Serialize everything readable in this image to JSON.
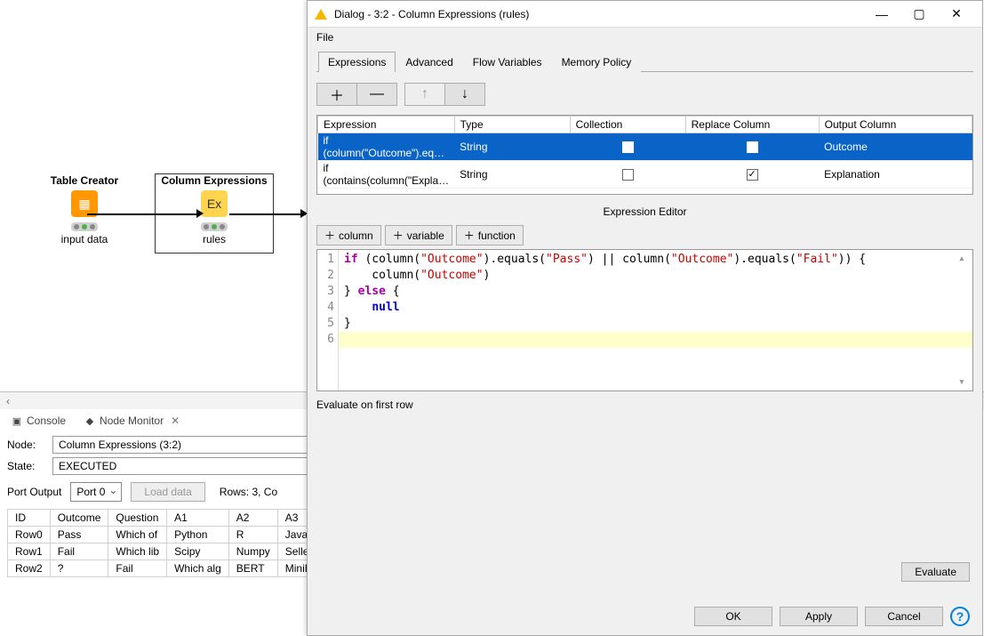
{
  "canvas": {
    "node1": {
      "title": "Table Creator",
      "caption": "input data"
    },
    "node2": {
      "title": "Column Expressions",
      "caption": "rules"
    }
  },
  "bottom_tabs": {
    "console": "Console",
    "monitor": "Node Monitor"
  },
  "monitor": {
    "node_label": "Node:",
    "node_value": "Column Expressions  (3:2)",
    "state_label": "State:",
    "state_value": "EXECUTED",
    "port_output": "Port Output",
    "port_selected": "Port 0",
    "load_btn": "Load data",
    "rows_text": "Rows: 3, Co",
    "columns": [
      "ID",
      "Outcome",
      "Question",
      "A1",
      "A2",
      "A3"
    ],
    "rows": [
      [
        "Row0",
        "Pass",
        "Which of",
        "Python",
        "R",
        "Java"
      ],
      [
        "Row1",
        "Fail",
        "Which lib",
        "Scipy",
        "Numpy",
        "Selleni"
      ],
      [
        "Row2",
        "?",
        "Fail",
        "Which alg",
        "BERT",
        "MiniBE"
      ]
    ]
  },
  "dialog": {
    "title": "Dialog - 3:2 - Column Expressions (rules)",
    "menu_file": "File",
    "tabs": [
      "Expressions",
      "Advanced",
      "Flow Variables",
      "Memory Policy"
    ],
    "cols": [
      "Expression",
      "Type",
      "Collection",
      "Replace Column",
      "Output Column"
    ],
    "expr_rows": [
      {
        "expr": "if (column(\"Outcome\").eq…",
        "type": "String",
        "collection": false,
        "replace": true,
        "out": "Outcome",
        "selected": true
      },
      {
        "expr": "if (contains(column(\"Expla…",
        "type": "String",
        "collection": false,
        "replace": true,
        "out": "Explanation",
        "selected": false
      }
    ],
    "editor_label": "Expression Editor",
    "editor_btn_column": "column",
    "editor_btn_variable": "variable",
    "editor_btn_function": "function",
    "code_lines": [
      {
        "n": 1,
        "raw": "if (column(\"Outcome\").equals(\"Pass\") || column(\"Outcome\").equals(\"Fail\")) {"
      },
      {
        "n": 2,
        "raw": "    column(\"Outcome\")"
      },
      {
        "n": 3,
        "raw": "} else {"
      },
      {
        "n": 4,
        "raw": "    null"
      },
      {
        "n": 5,
        "raw": "}"
      },
      {
        "n": 6,
        "raw": ""
      }
    ],
    "eval_label": "Evaluate on first row",
    "evaluate_btn": "Evaluate",
    "ok": "OK",
    "apply": "Apply",
    "cancel": "Cancel"
  }
}
